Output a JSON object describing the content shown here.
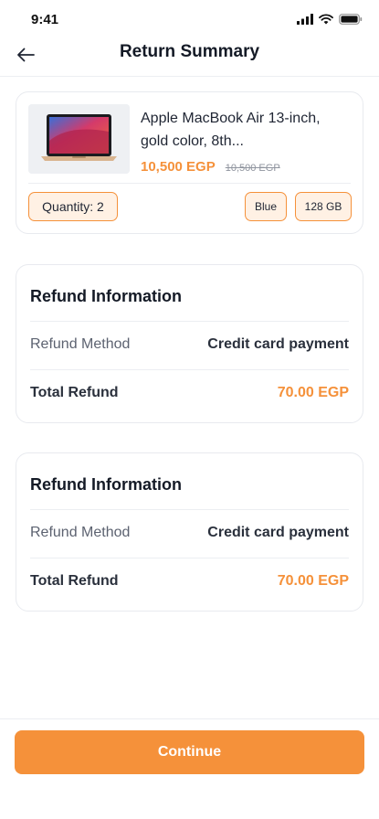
{
  "status_bar": {
    "time": "9:41"
  },
  "header": {
    "title": "Return Summary"
  },
  "product": {
    "title": "Apple MacBook Air 13-inch, gold color, 8th...",
    "price": "10,500 EGP",
    "old_price": "10,500 EGP",
    "quantity": "Quantity: 2",
    "color": "Blue",
    "storage": "128 GB"
  },
  "refund_cards": [
    {
      "title": "Refund Information",
      "method_label": "Refund Method",
      "method_value": "Credit card payment",
      "total_label": "Total Refund",
      "total_value": "70.00 EGP"
    },
    {
      "title": "Refund Information",
      "method_label": "Refund Method",
      "method_value": "Credit card payment",
      "total_label": "Total Refund",
      "total_value": "70.00 EGP"
    }
  ],
  "footer": {
    "continue_label": "Continue"
  },
  "colors": {
    "accent": "#f5913a",
    "accent_soft": "#fff1e4",
    "text_dark": "#141a26"
  },
  "icons": [
    "signal-icon",
    "wifi-icon",
    "battery-icon",
    "back-arrow-icon"
  ]
}
